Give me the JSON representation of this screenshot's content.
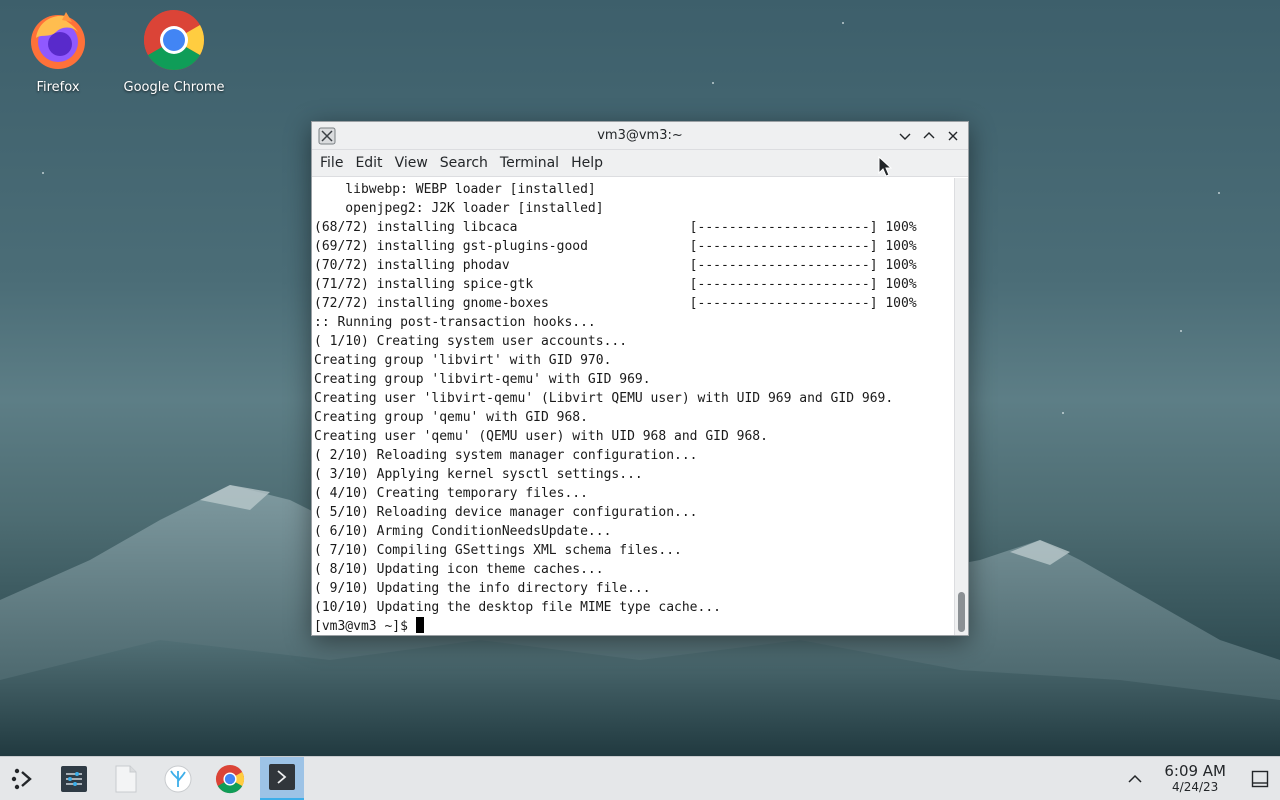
{
  "desktop": {
    "icons": [
      {
        "label": "Firefox"
      },
      {
        "label": "Google Chrome"
      }
    ]
  },
  "window": {
    "title": "vm3@vm3:~",
    "menu": [
      "File",
      "Edit",
      "View",
      "Search",
      "Terminal",
      "Help"
    ],
    "lines": [
      "    libwebp: WEBP loader [installed]",
      "    openjpeg2: J2K loader [installed]",
      "(68/72) installing libcaca                      [----------------------] 100%",
      "(69/72) installing gst-plugins-good             [----------------------] 100%",
      "(70/72) installing phodav                       [----------------------] 100%",
      "(71/72) installing spice-gtk                    [----------------------] 100%",
      "(72/72) installing gnome-boxes                  [----------------------] 100%",
      ":: Running post-transaction hooks...",
      "( 1/10) Creating system user accounts...",
      "Creating group 'libvirt' with GID 970.",
      "Creating group 'libvirt-qemu' with GID 969.",
      "Creating user 'libvirt-qemu' (Libvirt QEMU user) with UID 969 and GID 969.",
      "Creating group 'qemu' with GID 968.",
      "Creating user 'qemu' (QEMU user) with UID 968 and GID 968.",
      "( 2/10) Reloading system manager configuration...",
      "( 3/10) Applying kernel sysctl settings...",
      "( 4/10) Creating temporary files...",
      "( 5/10) Reloading device manager configuration...",
      "( 6/10) Arming ConditionNeedsUpdate...",
      "( 7/10) Compiling GSettings XML schema files...",
      "( 8/10) Updating icon theme caches...",
      "( 9/10) Updating the info directory file...",
      "(10/10) Updating the desktop file MIME type cache..."
    ],
    "prompt": "[vm3@vm3 ~]$ "
  },
  "taskbar": {
    "icons": [
      "app-launcher-icon",
      "settings-icon",
      "files-icon",
      "discover-icon",
      "chrome-icon",
      "terminal-icon"
    ],
    "active": "terminal-icon",
    "clock": {
      "time": "6:09 AM",
      "date": "4/24/23"
    }
  },
  "colors": {
    "accent": "#3daee9",
    "taskbar_bg": "#e5e7e9",
    "window_chrome": "#eff0f1"
  }
}
